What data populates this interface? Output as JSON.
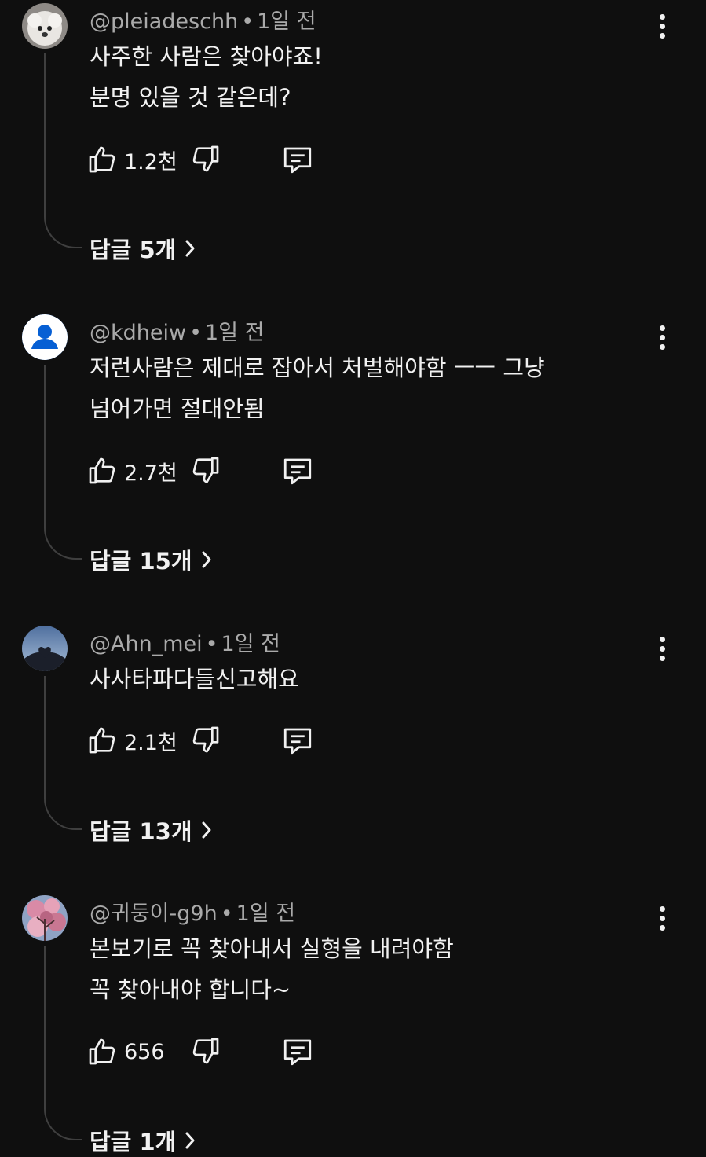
{
  "comments": [
    {
      "handle": "@pleiadeschh",
      "time": "1일 전",
      "lines": [
        "사주한 사람은 찾아야죠!",
        "분명 있을 것 같은데?"
      ],
      "likes": "1.2천",
      "replies": "답글 5개",
      "avatar": "white-dog-photo"
    },
    {
      "handle": "@kdheiw",
      "time": "1일 전",
      "lines": [
        "저런사람은 제대로 잡아서 처벌해야함 ㅡㅡ 그냥",
        "넘어가면 절대안됨"
      ],
      "likes": "2.7천",
      "replies": "답글 15개",
      "avatar": "default-person-icon"
    },
    {
      "handle": "@Ahn_mei",
      "time": "1일 전",
      "lines": [
        "사사타파다들신고해요"
      ],
      "likes": "2.1천",
      "replies": "답글 13개",
      "avatar": "sky-heart-hands-photo"
    },
    {
      "handle": "@귀둥이-g9h",
      "time": "1일 전",
      "lines": [
        "본보기로 꼭 찾아내서 실형을 내려야함",
        "꼭 찾아내야 합니다~"
      ],
      "likes": "656",
      "replies": "답글 1개",
      "avatar": "pink-blossom-photo"
    }
  ],
  "colors": {
    "background": "#0f0f0f",
    "text": "#f1f1f1",
    "meta": "#aaaaaa",
    "thread": "#3f3f3f",
    "default_avatar_bg": "#065fd4"
  }
}
